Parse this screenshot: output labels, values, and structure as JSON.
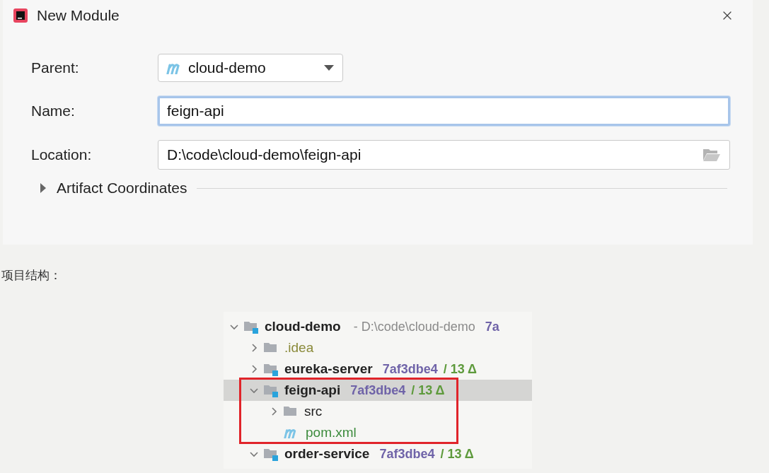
{
  "dialog": {
    "title": "New Module",
    "fields": [
      {
        "kind": "dropdown",
        "label": "Parent:",
        "value": "cloud-demo"
      },
      {
        "kind": "text",
        "label": "Name:",
        "value": "feign-api",
        "focused": true
      },
      {
        "kind": "path",
        "label": "Location:",
        "value": "D:\\code\\cloud-demo\\feign-api",
        "focused": false
      }
    ],
    "section": {
      "label": "Artifact Coordinates",
      "expanded": false
    }
  },
  "caption": "项目结构：",
  "tree": [
    {
      "kind": "module",
      "name": "cloud-demo",
      "path": "- D:\\code\\cloud-demo",
      "hash": "7a",
      "expanded": true,
      "selected": false,
      "children": [
        {
          "kind": "folder",
          "name": ".idea",
          "expanded": false,
          "selected": false
        },
        {
          "kind": "module",
          "name": "eureka-server",
          "hash": "7af3dbe4",
          "changes": "/ 13 Δ",
          "expanded": false,
          "selected": false
        },
        {
          "kind": "module",
          "name": "feign-api",
          "hash": "7af3dbe4",
          "changes": "/ 13 Δ",
          "expanded": true,
          "selected": true,
          "highlighted": true,
          "children": [
            {
              "kind": "folder",
              "name": "src",
              "expanded": false,
              "selected": false
            },
            {
              "kind": "pom",
              "name": "pom.xml",
              "selected": false
            }
          ]
        },
        {
          "kind": "module",
          "name": "order-service",
          "hash": "7af3dbe4",
          "changes": "/ 13 Δ",
          "expanded": true,
          "selected": false
        }
      ]
    }
  ]
}
